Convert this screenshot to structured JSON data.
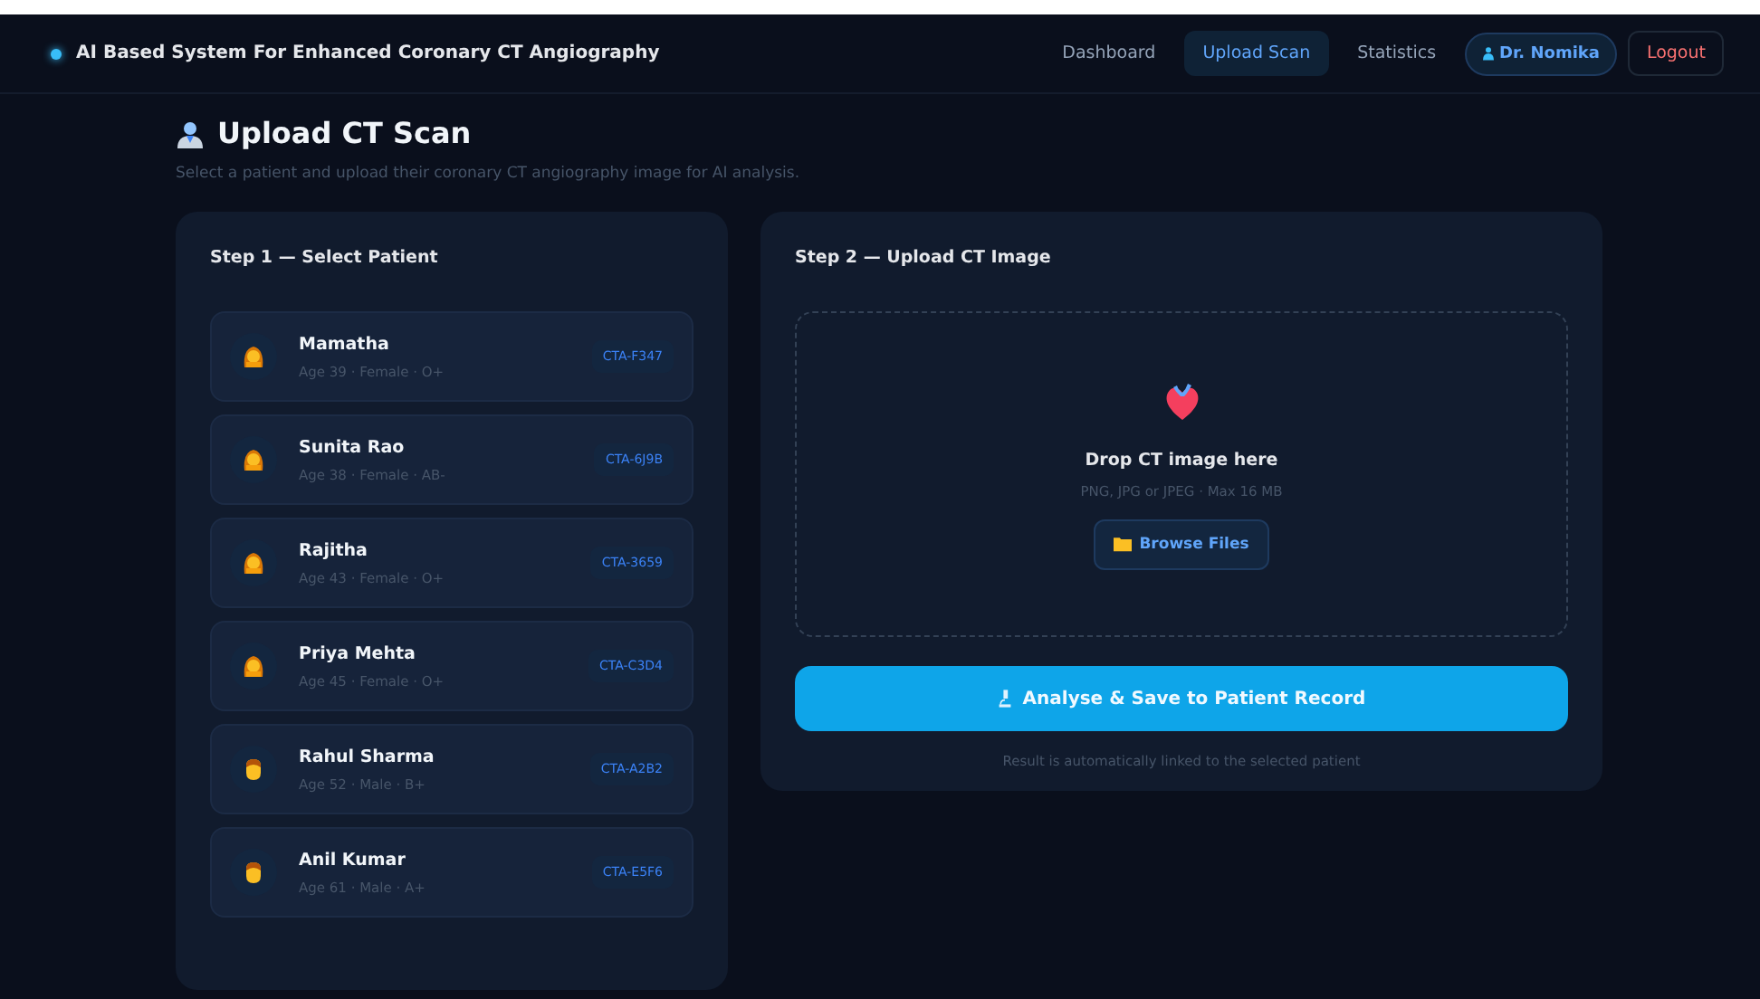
{
  "app_title": "AI Based System For Enhanced Coronary CT Angiography",
  "nav": [
    {
      "label": "Dashboard",
      "selected": false
    },
    {
      "label": "Upload Scan",
      "selected": true
    },
    {
      "label": "Statistics",
      "selected": false
    }
  ],
  "user": "Dr. Nomika",
  "logout": "Logout",
  "page": {
    "title": "Upload CT Scan",
    "subtitle": "Select a patient and upload their coronary CT angiography image for AI analysis."
  },
  "step1": {
    "title": "Step 1 — Select Patient",
    "patients": [
      {
        "name": "Mamatha",
        "details": "Age 39 · Female · O+",
        "id": "CTA-F347",
        "kind": "female",
        "selected": false
      },
      {
        "name": "Sunita Rao",
        "details": "Age 38 · Female · AB-",
        "id": "CTA-6J9B",
        "kind": "female",
        "selected": false
      },
      {
        "name": "Rajitha",
        "details": "Age 43 · Female · O+",
        "id": "CTA-3659",
        "kind": "female",
        "selected": false
      },
      {
        "name": "Priya Mehta",
        "details": "Age 45 · Female · O+",
        "id": "CTA-C3D4",
        "kind": "female",
        "selected": false
      },
      {
        "name": "Rahul Sharma",
        "details": "Age 52 · Male · B+",
        "id": "CTA-A2B2",
        "kind": "male",
        "selected": false
      },
      {
        "name": "Anil Kumar",
        "details": "Age 61 · Male · A+",
        "id": "CTA-E5F6",
        "kind": "male",
        "selected": false
      }
    ]
  },
  "step2": {
    "title": "Step 2 — Upload CT Image",
    "drop_title": "Drop CT image here",
    "drop_hint": "PNG, JPG or JPEG · Max 16 MB",
    "browse": "Browse Files",
    "analyse": "Analyse & Save to Patient Record",
    "note": "Result is automatically linked to the selected patient"
  }
}
